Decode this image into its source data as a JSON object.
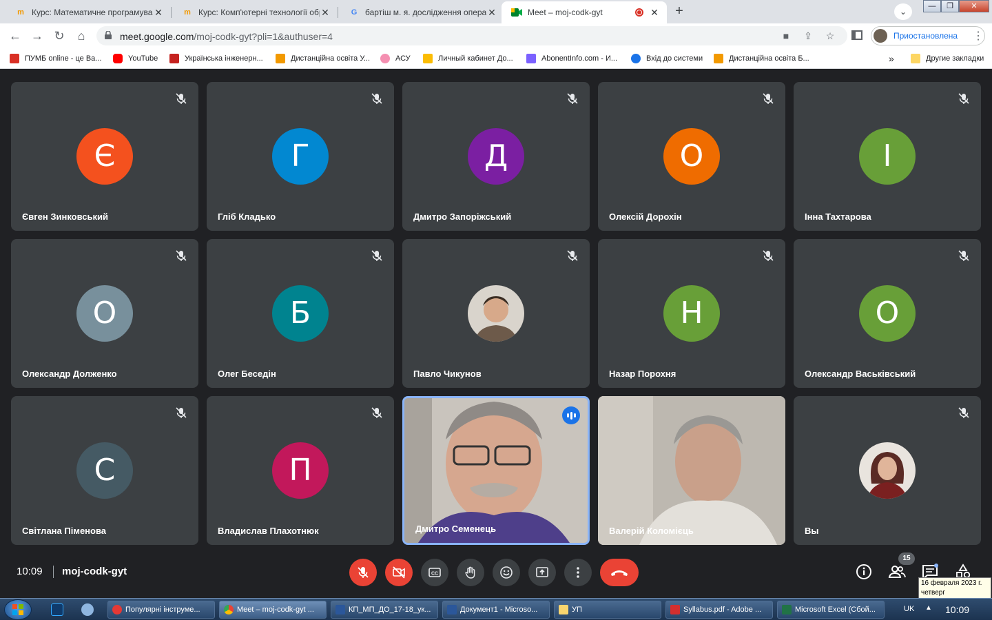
{
  "browser": {
    "tabs": [
      {
        "title": "Курс: Математичне програмування",
        "icon": "moodle-icon",
        "active": false
      },
      {
        "title": "Курс: Комп'ютерні технології обробки",
        "icon": "moodle-icon",
        "active": false
      },
      {
        "title": "бартіш м. я. дослідження операцій",
        "icon": "google-icon",
        "active": false
      },
      {
        "title": "Meet – moj-codk-gyt",
        "icon": "meet-icon",
        "active": true
      }
    ],
    "new_tab_label": "+",
    "url_host": "meet.google.com",
    "url_path": "/moj-codk-gyt?pli=1&authuser=4",
    "profile_label": "Приостановлена",
    "bookmarks": [
      {
        "label": "ПУМБ online - це Ва...",
        "icon": "pumb-icon",
        "color": "#d93025"
      },
      {
        "label": "YouTube",
        "icon": "youtube-icon",
        "color": "#ff0000"
      },
      {
        "label": "Українська інженерн...",
        "icon": "uiia-icon",
        "color": "#c5221f"
      },
      {
        "label": "Дистанційна освіта У...",
        "icon": "moodle-icon",
        "color": "#f29900"
      },
      {
        "label": "АСУ",
        "icon": "asu-icon",
        "color": "#f48fb1"
      },
      {
        "label": "Личный кабинет До...",
        "icon": "cabinet-icon",
        "color": "#fbbc04"
      },
      {
        "label": "AbonentInfo.com - И...",
        "icon": "abonentinfo-icon",
        "color": "#7b61ff"
      },
      {
        "label": "Вхід до системи",
        "icon": "kyivstar-icon",
        "color": "#1a73e8"
      },
      {
        "label": "Дистанційна освіта Б...",
        "icon": "moodle-icon",
        "color": "#f29900"
      }
    ],
    "more_bookmarks": "»",
    "other_bookmarks": "Другие закладки"
  },
  "meet": {
    "participants": [
      {
        "name": "Євген Зинковський",
        "initial": "Є",
        "color": "#f4511e",
        "type": "initial",
        "muted": true
      },
      {
        "name": "Гліб Кладько",
        "initial": "Г",
        "color": "#0288d1",
        "type": "initial",
        "muted": true
      },
      {
        "name": "Дмитро Запоріжський",
        "initial": "Д",
        "color": "#7b1fa2",
        "type": "initial",
        "muted": true
      },
      {
        "name": "Олексій Дорохін",
        "initial": "О",
        "color": "#ef6c00",
        "type": "initial",
        "muted": true
      },
      {
        "name": "Інна Тахтарова",
        "initial": "І",
        "color": "#689f38",
        "type": "initial",
        "muted": true
      },
      {
        "name": "Олександр Долженко",
        "initial": "О",
        "color": "#78909c",
        "type": "initial",
        "muted": true
      },
      {
        "name": "Олег Беседін",
        "initial": "Б",
        "color": "#00838f",
        "type": "initial",
        "muted": true
      },
      {
        "name": "Павло Чикунов",
        "initial": "",
        "color": "#8d6e63",
        "type": "photo",
        "muted": true
      },
      {
        "name": "Назар Порохня",
        "initial": "Н",
        "color": "#689f38",
        "type": "initial",
        "muted": true
      },
      {
        "name": "Олександр Васьківський",
        "initial": "О",
        "color": "#689f38",
        "type": "initial",
        "muted": true
      },
      {
        "name": "Світлана Піменова",
        "initial": "С",
        "color": "#455a64",
        "type": "initial",
        "muted": true
      },
      {
        "name": "Владислав Плахотнюк",
        "initial": "П",
        "color": "#c2185b",
        "type": "initial",
        "muted": true
      },
      {
        "name": "Дмитро Семенець",
        "initial": "",
        "color": "#5a4e8c",
        "type": "video",
        "muted": false,
        "speaking": true
      },
      {
        "name": "Валерій Коломієць",
        "initial": "",
        "color": "#a8a49c",
        "type": "video",
        "muted": false
      },
      {
        "name": "Вы",
        "initial": "",
        "color": "#8d2e2e",
        "type": "photo",
        "muted": true
      }
    ],
    "time": "10:09",
    "meeting_code": "moj-codk-gyt",
    "people_count": "15"
  },
  "taskbar": {
    "tasks": [
      {
        "label": "Популярні інструме...",
        "icon": "opera-icon",
        "color": "#e53935"
      },
      {
        "label": "Meet – moj-codk-gyt ...",
        "icon": "chrome-icon",
        "color": "#fbbc04",
        "active": true
      },
      {
        "label": "КП_МП_ДО_17-18_ук...",
        "icon": "word-icon",
        "color": "#2b579a"
      },
      {
        "label": "Документ1 - Microso...",
        "icon": "word-icon",
        "color": "#2b579a"
      },
      {
        "label": "УП",
        "icon": "folder-icon",
        "color": "#f9d56e"
      },
      {
        "label": "Syllabus.pdf - Adobe ...",
        "icon": "pdf-icon",
        "color": "#d32f2f"
      },
      {
        "label": "Microsoft Excel (Сбой...",
        "icon": "excel-icon",
        "color": "#217346"
      }
    ],
    "language": "UK",
    "clock": "10:09",
    "tooltip_date": "16 февраля 2023 г.",
    "tooltip_day": "четверг"
  }
}
